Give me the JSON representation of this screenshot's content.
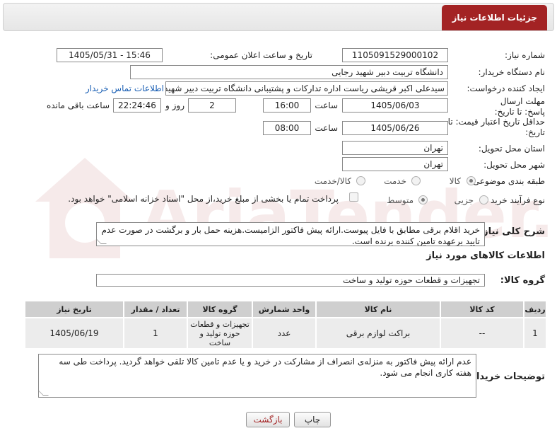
{
  "title": "جزئیات اطلاعات نیاز",
  "fields": {
    "need_number_label": "شماره نیاز:",
    "need_number": "1105091529000102",
    "announce_label": "تاریخ و ساعت اعلان عمومی:",
    "announce_value": "1405/05/31 - 15:46",
    "buyer_org_label": "نام دستگاه خریدار:",
    "buyer_org": "دانشگاه تربیت دبیر شهید رجایی",
    "creator_label": "ایجاد کننده درخواست:",
    "creator": "سیدعلی اکبر قریشی ریاست اداره تدارکات و پشتیبانی دانشگاه تربیت دبیر شهید",
    "contact_link": "اطلاعات تماس خریدار",
    "deadline_label": "مهلت ارسال پاسخ: تا تاریخ:",
    "deadline_date": "1405/06/03",
    "time_label": "ساعت",
    "deadline_time": "16:00",
    "days_value": "2",
    "days_label": "روز و",
    "remaining_time": "22:24:46",
    "remaining_label": "ساعت باقی مانده",
    "validity_label": "حداقل تاریخ اعتبار قیمت: تا تاریخ:",
    "validity_date": "1405/06/26",
    "validity_time": "08:00",
    "province_label": "استان محل تحویل:",
    "province": "تهران",
    "city_label": "شهر محل تحویل:",
    "city": "تهران",
    "category_label": "طبقه بندی موضوعی:",
    "cat_goods": "کالا",
    "cat_service": "خدمت",
    "cat_goods_service": "کالا/خدمت",
    "process_label": "نوع فرآیند خرید :",
    "proc_partial": "جزیی",
    "proc_medium": "متوسط",
    "payment_note": "پرداخت تمام یا بخشی از مبلغ خرید،از محل \"اسناد خزانه اسلامی\" خواهد بود.",
    "description_label": "شرح کلی نیاز:",
    "description": "خرید اقلام برقی مطابق با فایل پیوست.ارائه پیش فاکتور الزامیست.هزینه حمل بار و برگشت در صورت عدم تایید برعهده تامین کننده برنده است.",
    "goods_info_title": "اطلاعات کالاهای مورد نیاز",
    "goods_group_label": "گروه کالا:",
    "goods_group": "تجهیزات و قطعات حوزه تولید و ساخت",
    "buyer_notes_label": "توضیحات خریدار:",
    "buyer_notes": "عدم ارائه پیش فاکتور به منزله‌ی انصراف از مشارکت در خرید و یا عدم تامین کالا تلقی خواهد گردید. پرداخت طی سه هفته کاری انجام می شود."
  },
  "table": {
    "headers": [
      "ردیف",
      "کد کالا",
      "نام کالا",
      "واحد شمارش",
      "گروه کالا",
      "تعداد / مقدار",
      "تاریخ نیاز"
    ],
    "rows": [
      [
        "1",
        "--",
        "براکت لوازم برقی",
        "عدد",
        "تجهیزات و قطعات حوزه تولید و ساخت",
        "1",
        "1405/06/19"
      ]
    ]
  },
  "buttons": {
    "print": "چاپ",
    "back": "بازگشت"
  },
  "watermark": "AriaTender.net",
  "colors": {
    "accent": "#a32324",
    "header_cell": "#cfcfcf",
    "cell": "#ececec",
    "link": "#1a5fb4"
  }
}
